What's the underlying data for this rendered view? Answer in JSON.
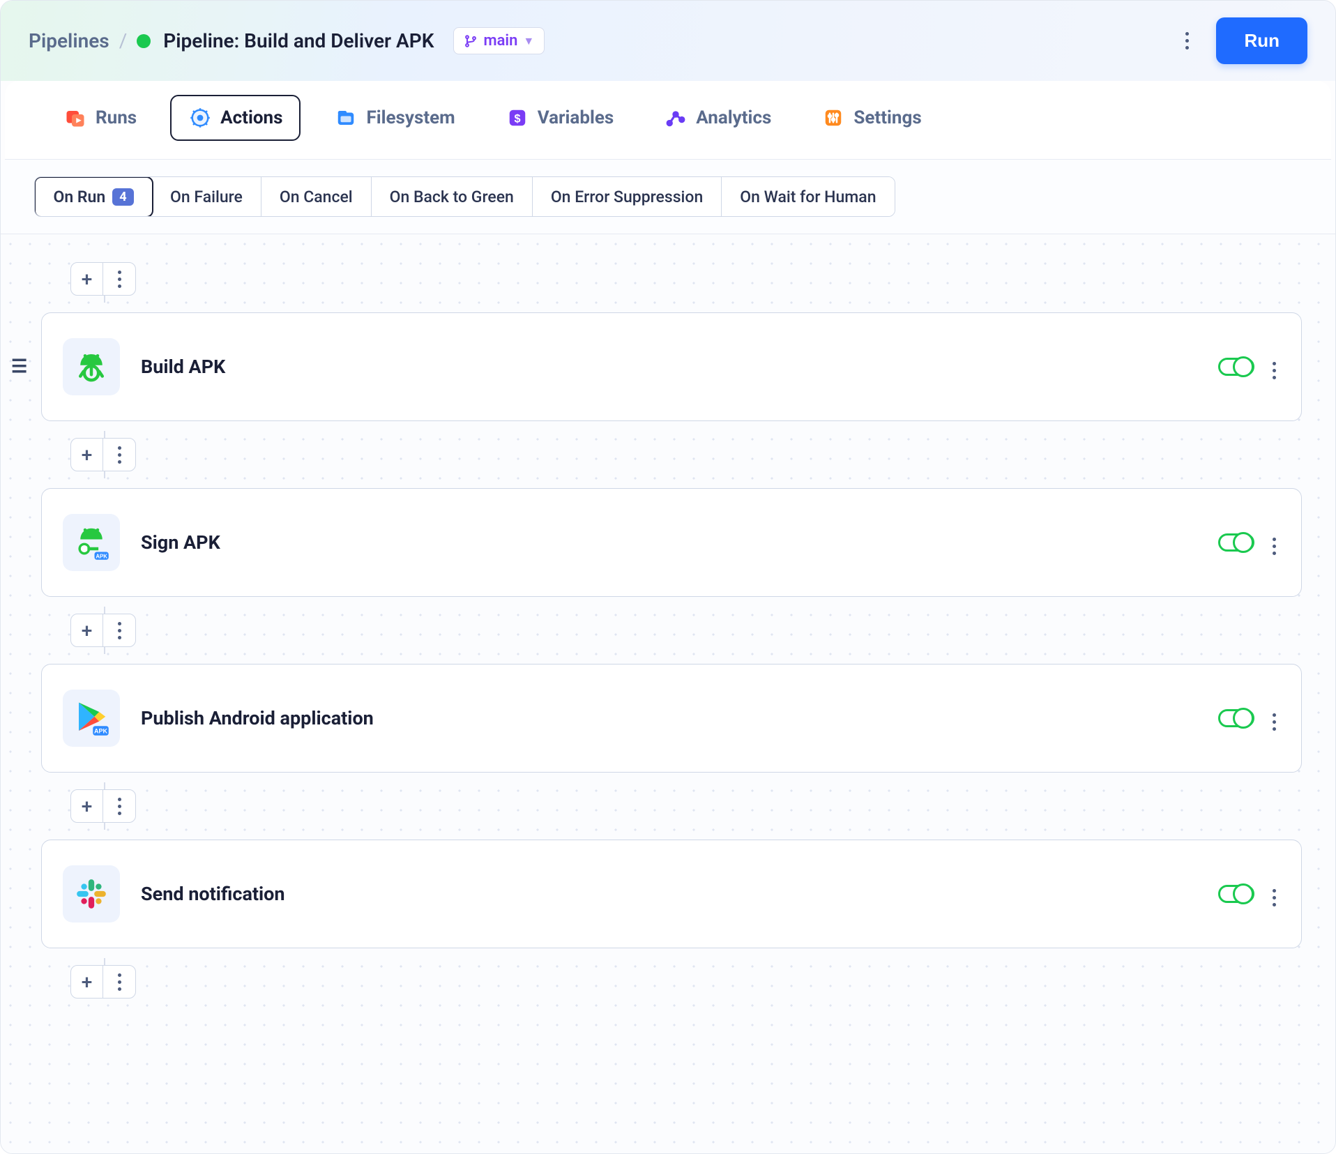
{
  "breadcrumb": {
    "root": "Pipelines",
    "title": "Pipeline: Build and Deliver APK"
  },
  "branch": {
    "label": "main"
  },
  "run_button": "Run",
  "tabs": [
    {
      "id": "runs",
      "label": "Runs",
      "color": "#ff4d3a"
    },
    {
      "id": "actions",
      "label": "Actions",
      "color": "#2f8bff",
      "active": true
    },
    {
      "id": "filesystem",
      "label": "Filesystem",
      "color": "#2f8bff"
    },
    {
      "id": "variables",
      "label": "Variables",
      "color": "#7a3cf5"
    },
    {
      "id": "analytics",
      "label": "Analytics",
      "color": "#6a3cf5"
    },
    {
      "id": "settings",
      "label": "Settings",
      "color": "#ff8a1f"
    }
  ],
  "subtabs": [
    {
      "label": "On Run",
      "badge": "4",
      "active": true
    },
    {
      "label": "On Failure"
    },
    {
      "label": "On Cancel"
    },
    {
      "label": "On Back to Green"
    },
    {
      "label": "On Error Suppression"
    },
    {
      "label": "On Wait for Human"
    }
  ],
  "actions": [
    {
      "name": "Build APK",
      "icon": "android-build"
    },
    {
      "name": "Sign APK",
      "icon": "android-sign"
    },
    {
      "name": "Publish Android application",
      "icon": "play-store"
    },
    {
      "name": "Send notification",
      "icon": "slack"
    }
  ]
}
